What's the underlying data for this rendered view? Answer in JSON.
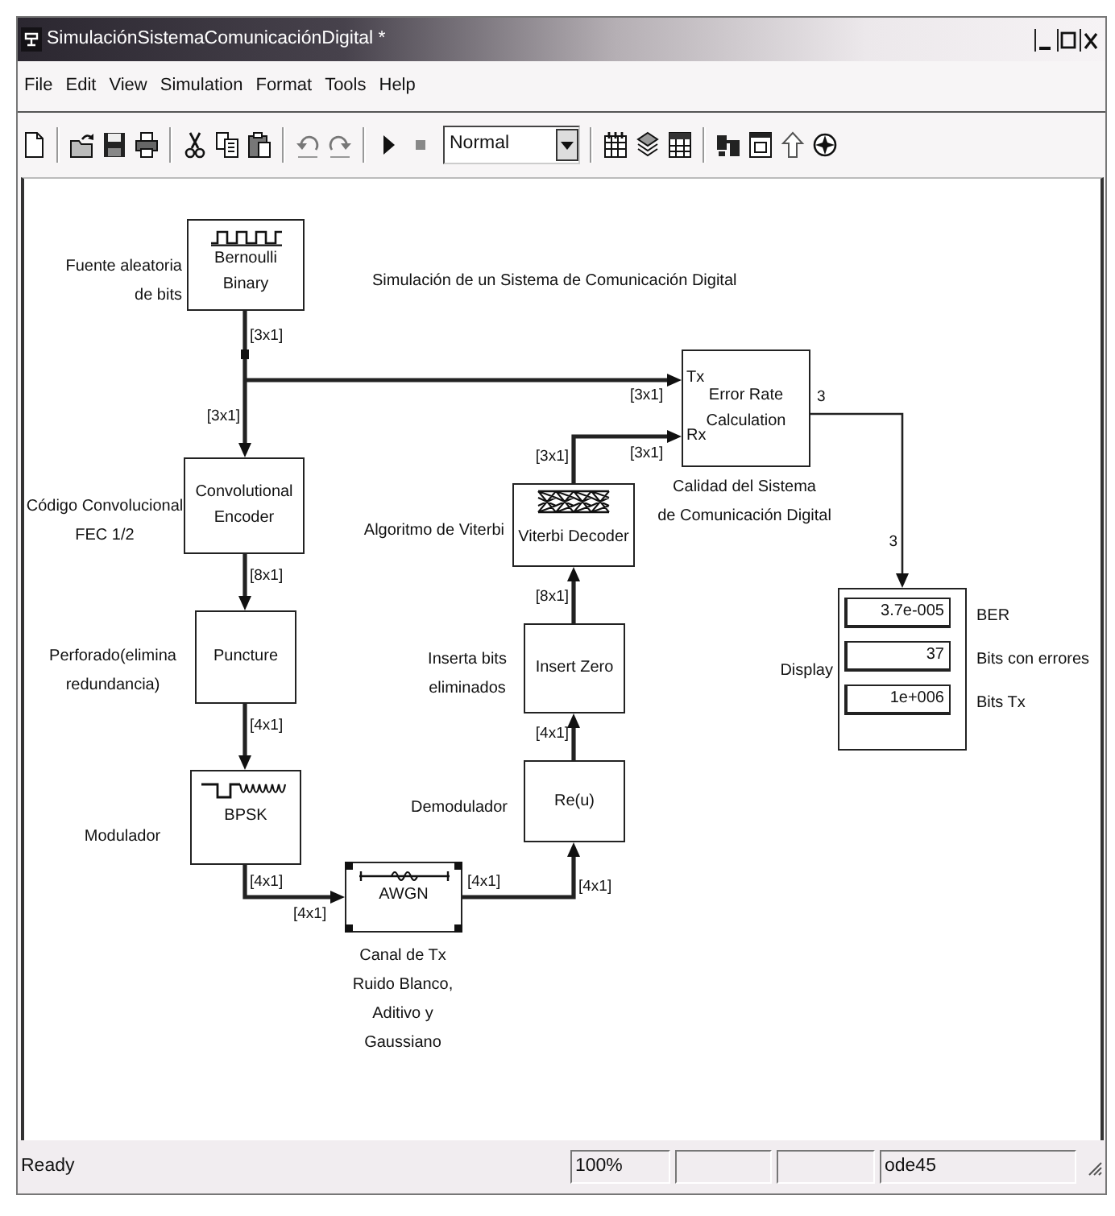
{
  "window": {
    "title": "SimulaciónSistemaComunicaciónDigital *"
  },
  "menu": [
    "File",
    "Edit",
    "View",
    "Simulation",
    "Format",
    "Tools",
    "Help"
  ],
  "toolbar": {
    "simulation_mode": "Normal"
  },
  "diagram": {
    "title": "Simulación de un Sistema de Comunicación Digital",
    "blocks": [
      {
        "kind": "pulse",
        "lines": [
          "Bernoulli",
          "Binary"
        ],
        "annotation": [
          "Fuente aleatoria",
          "de bits"
        ],
        "selected": false
      },
      {
        "kind": "plain",
        "lines": [
          "Convolutional",
          "Encoder"
        ],
        "annotation": [
          "Código Convolucional",
          "FEC 1/2"
        ],
        "selected": false
      },
      {
        "kind": "ports",
        "ports": [
          "Tx",
          "Rx"
        ],
        "lines": [
          "Error Rate",
          "Calculation"
        ],
        "annotation": [
          "Calidad del Sistema",
          "de Comunicación Digital"
        ],
        "selected": false
      },
      {
        "kind": "trellis",
        "lines": [
          "Viterbi Decoder"
        ],
        "annotation": [
          "Algoritmo de Viterbi"
        ],
        "selected": false
      },
      {
        "kind": "plain",
        "lines": [
          "Puncture"
        ],
        "annotation": [
          "Perforado(elimina",
          "redundancia)"
        ],
        "selected": false
      },
      {
        "kind": "plain",
        "lines": [
          "Insert Zero"
        ],
        "annotation": [
          "Inserta bits",
          "eliminados"
        ],
        "selected": false
      },
      {
        "kind": "display",
        "rows": [
          {
            "value": "3.7e-005",
            "label": "BER"
          },
          {
            "value": "37",
            "label": "Bits con errores"
          },
          {
            "value": "1e+006",
            "label": "Bits Tx"
          }
        ],
        "annotation": [
          "Display"
        ],
        "selected": false
      },
      {
        "kind": "modulation",
        "lines": [
          "BPSK"
        ],
        "annotation": [
          "Modulador"
        ],
        "selected": false
      },
      {
        "kind": "plain",
        "lines": [
          "Re(u)"
        ],
        "annotation": [
          "Demodulador"
        ],
        "selected": false
      },
      {
        "kind": "noise",
        "lines": [
          "AWGN"
        ],
        "annotation": [
          "Canal de Tx",
          "Ruido Blanco,",
          "Aditivo y",
          "Gaussiano"
        ],
        "selected": true
      }
    ],
    "signals": [
      {
        "labels": [
          "[3x1]",
          "[3x1]"
        ]
      },
      {
        "labels": [
          "[3x1]"
        ]
      },
      {
        "labels": [
          "[3x1]",
          "[3x1]"
        ]
      },
      {
        "labels": [
          "[8x1]"
        ]
      },
      {
        "labels": [
          "[8x1]"
        ]
      },
      {
        "labels": [
          "3",
          "3"
        ]
      },
      {
        "labels": [
          "[4x1]"
        ]
      },
      {
        "labels": [
          "[4x1]"
        ]
      },
      {
        "labels": [
          "[4x1]",
          "[4x1]"
        ]
      },
      {
        "labels": [
          "[4x1]",
          "[4x1]"
        ]
      }
    ]
  },
  "status_bar": {
    "message": "Ready",
    "zoom": "100%",
    "solver": "ode45"
  }
}
